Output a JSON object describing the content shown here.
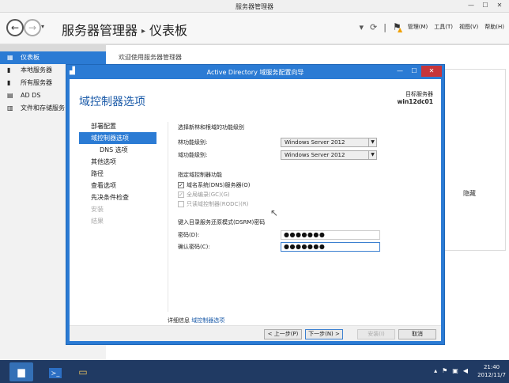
{
  "server_manager": {
    "window_title": "服务器管理器",
    "breadcrumb_root": "服务器管理器",
    "breadcrumb_sep": "▸",
    "breadcrumb_page": "仪表板",
    "menu_manage": "管理(M)",
    "menu_tools": "工具(T)",
    "menu_view": "视图(V)",
    "menu_help": "帮助(H)",
    "sidebar": [
      {
        "label": "仪表板",
        "icon": "dashboard-icon",
        "active": true
      },
      {
        "label": "本地服务器",
        "icon": "server-icon"
      },
      {
        "label": "所有服务器",
        "icon": "servers-icon"
      },
      {
        "label": "AD DS",
        "icon": "ad-ds-icon"
      },
      {
        "label": "文件和存储服务",
        "icon": "storage-icon"
      }
    ],
    "welcome": "欢迎使用服务器管理器",
    "hide_label": "隐藏"
  },
  "wizard": {
    "title": "Active Directory 域服务配置向导",
    "heading": "域控制器选项",
    "target_label": "目标服务器",
    "target_server": "win12dc01",
    "steps": [
      {
        "label": "部署配置",
        "state": "normal"
      },
      {
        "label": "域控制器选项",
        "state": "active"
      },
      {
        "label": "DNS 选项",
        "state": "sub"
      },
      {
        "label": "其他选项",
        "state": "normal"
      },
      {
        "label": "路径",
        "state": "normal"
      },
      {
        "label": "查看选项",
        "state": "normal"
      },
      {
        "label": "先决条件检查",
        "state": "normal"
      },
      {
        "label": "安装",
        "state": "disabled"
      },
      {
        "label": "结果",
        "state": "disabled"
      }
    ],
    "section_level": "选择新林和根域的功能级别",
    "forest_level_label": "林功能级别:",
    "forest_level_value": "Windows Server 2012",
    "domain_level_label": "域功能级别:",
    "domain_level_value": "Windows Server 2012",
    "section_capabilities": "指定域控制器功能",
    "chk_dns": {
      "label": "域名系统(DNS)服务器(O)",
      "checked": true,
      "enabled": true
    },
    "chk_gc": {
      "label": "全局编录(GC)(G)",
      "checked": true,
      "enabled": false
    },
    "chk_rodc": {
      "label": "只读域控制器(RODC)(R)",
      "checked": false,
      "enabled": false
    },
    "section_dsrm": "键入目录服务还原模式(DSRM)密码",
    "password_label": "密码(D):",
    "password_value": "●●●●●●●",
    "confirm_label": "确认密码(C):",
    "confirm_value": "●●●●●●●",
    "more_info_label": "详细信息",
    "more_info_link": "域控制器选项",
    "btn_prev": "< 上一步(P)",
    "btn_next": "下一步(N) >",
    "btn_install": "安装(I)",
    "btn_cancel": "取消"
  },
  "taskbar": {
    "time": "21:40",
    "date": "2012/11/7"
  }
}
